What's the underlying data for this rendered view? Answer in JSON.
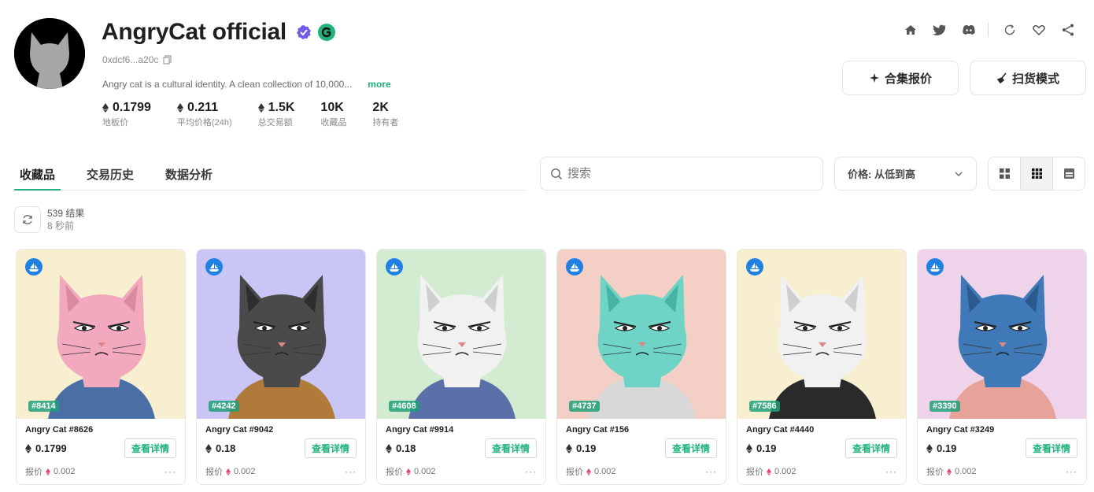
{
  "collection": {
    "name": "AngryCat official",
    "address": "0xdcf6...a20c",
    "description": "Angry cat is a cultural identity. A clean collection of 10,000...",
    "more_label": "more"
  },
  "stats": [
    {
      "value": "0.1799",
      "label": "地板价",
      "eth": true
    },
    {
      "value": "0.211",
      "label": "平均价格(24h)",
      "eth": true
    },
    {
      "value": "1.5K",
      "label": "总交易额",
      "eth": true
    },
    {
      "value": "10K",
      "label": "收藏品",
      "eth": false
    },
    {
      "value": "2K",
      "label": "持有者",
      "eth": false
    }
  ],
  "buttons": {
    "offer": "合集报价",
    "sweep": "扫货模式"
  },
  "tabs": [
    {
      "label": "收藏品",
      "active": true
    },
    {
      "label": "交易历史",
      "active": false
    },
    {
      "label": "数据分析",
      "active": false
    }
  ],
  "search": {
    "placeholder": "搜索"
  },
  "sort": {
    "label": "价格: 从低到高"
  },
  "results": {
    "count": "539 结果",
    "time": "8 秒前"
  },
  "colors": {
    "accent": "#1fb37a",
    "chain": "#2081e2"
  },
  "cards": [
    {
      "rank": "#8414",
      "name": "Angry Cat #8626",
      "price": "0.1799",
      "detail": "查看详情",
      "offer_label": "报价",
      "offer": "0.002",
      "bg": "#f7efcf",
      "fur": "#f2a9bd",
      "fur_dark": "#d98aa0",
      "shirt": "#4a6fa5"
    },
    {
      "rank": "#4242",
      "name": "Angry Cat #9042",
      "price": "0.18",
      "detail": "查看详情",
      "offer_label": "报价",
      "offer": "0.002",
      "bg": "#c9c5f4",
      "fur": "#4a4a4a",
      "fur_dark": "#2e2e2e",
      "shirt": "#b07a3a"
    },
    {
      "rank": "#4608",
      "name": "Angry Cat #9914",
      "price": "0.18",
      "detail": "查看详情",
      "offer_label": "报价",
      "offer": "0.002",
      "bg": "#d3ecd1",
      "fur": "#f1f1f1",
      "fur_dark": "#cfcfcf",
      "shirt": "#5b6fa8"
    },
    {
      "rank": "#4737",
      "name": "Angry Cat #156",
      "price": "0.19",
      "detail": "查看详情",
      "offer_label": "报价",
      "offer": "0.002",
      "bg": "#f3cfc6",
      "fur": "#6fd4c6",
      "fur_dark": "#47b3a5",
      "shirt": "#d8d8d8"
    },
    {
      "rank": "#7586",
      "name": "Angry Cat #4440",
      "price": "0.19",
      "detail": "查看详情",
      "offer_label": "报价",
      "offer": "0.002",
      "bg": "#f7efcf",
      "fur": "#f1f1f1",
      "fur_dark": "#cfcfcf",
      "shirt": "#2a2a2a"
    },
    {
      "rank": "#3390",
      "name": "Angry Cat #3249",
      "price": "0.19",
      "detail": "查看详情",
      "offer_label": "报价",
      "offer": "0.002",
      "bg": "#efd3ea",
      "fur": "#3f79b8",
      "fur_dark": "#2c5a8e",
      "shirt": "#e7a39a"
    }
  ]
}
